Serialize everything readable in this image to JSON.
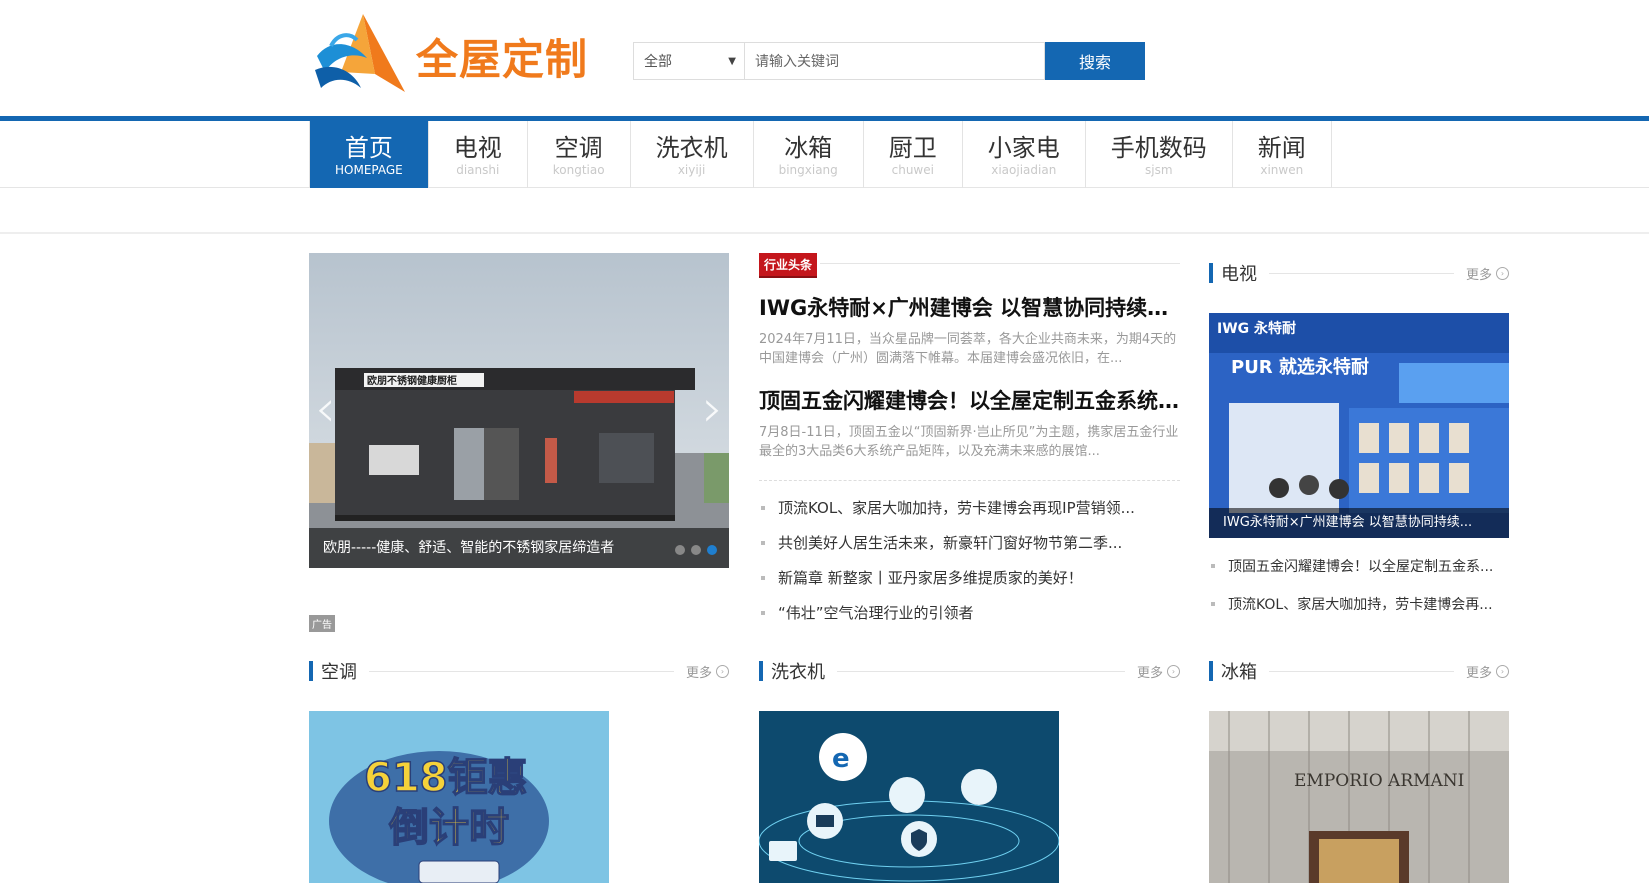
{
  "header": {
    "logo_text": "全屋定制",
    "search": {
      "category": "全部",
      "placeholder": "请输入关键词",
      "button": "搜索"
    }
  },
  "nav": [
    {
      "cn": "首页",
      "py": "HOMEPAGE",
      "active": true
    },
    {
      "cn": "电视",
      "py": "dianshi"
    },
    {
      "cn": "空调",
      "py": "kongtiao"
    },
    {
      "cn": "洗衣机",
      "py": "xiyiji"
    },
    {
      "cn": "冰箱",
      "py": "bingxiang"
    },
    {
      "cn": "厨卫",
      "py": "chuwei"
    },
    {
      "cn": "小家电",
      "py": "xiaojiadian"
    },
    {
      "cn": "手机数码",
      "py": "sjsm"
    },
    {
      "cn": "新闻",
      "py": "xinwen"
    }
  ],
  "slider": {
    "caption": "欧朋-----健康、舒适、智能的不锈钢家居缔造者",
    "sign_text": "欧朋不锈钢健康厨柜",
    "current": 3,
    "total": 3
  },
  "ad_label": "广告",
  "headlines": {
    "tag": "行业头条",
    "items": [
      {
        "title": "IWG永特耐×广州建博会 以智慧协同持续改...",
        "desc": "2024年7月11日，当众星品牌一同荟萃，各大企业共商未来，为期4天的中国建博会（广州）圆满落下帷幕。本届建博会盛况依旧，在..."
      },
      {
        "title": "顶固五金闪耀建博会！以全屋定制五金系统解...",
        "desc": "7月8日-11日，顶固五金以“顶固新界·岂止所见”为主题，携家居五金行业最全的3大品类6大系统产品矩阵，以及充满未来感的展馆..."
      }
    ],
    "list": [
      "顶流KOL、家居大咖加持，劳卡建博会再现IP营销领...",
      "共创美好人居生活未来，新豪轩门窗好物节第二季...",
      "新篇章 新整家丨亚丹家居多维提质家的美好！",
      "“伟壮”空气治理行业的引领者"
    ]
  },
  "tv": {
    "title": "电视",
    "more": "更多",
    "card_caption": "IWG永特耐×广州建博会 以智慧协同持续...",
    "card_banner": "PUR 就选永特耐",
    "card_brand": "IWG 永特耐",
    "list": [
      "顶固五金闪耀建博会！以全屋定制五金系...",
      "顶流KOL、家居大咖加持，劳卡建博会再..."
    ]
  },
  "sections": [
    {
      "title": "空调",
      "more": "更多"
    },
    {
      "title": "洗衣机",
      "more": "更多"
    },
    {
      "title": "冰箱",
      "more": "更多"
    }
  ],
  "thumbs": {
    "ac_text_1": "618钜惠",
    "ac_text_2": "倒计时",
    "fridge_text": "EMPORIO ARMANI"
  },
  "colors": {
    "brand_blue": "#1467b2",
    "logo_orange": "#f07a1c",
    "tag_red": "#c4161c"
  }
}
